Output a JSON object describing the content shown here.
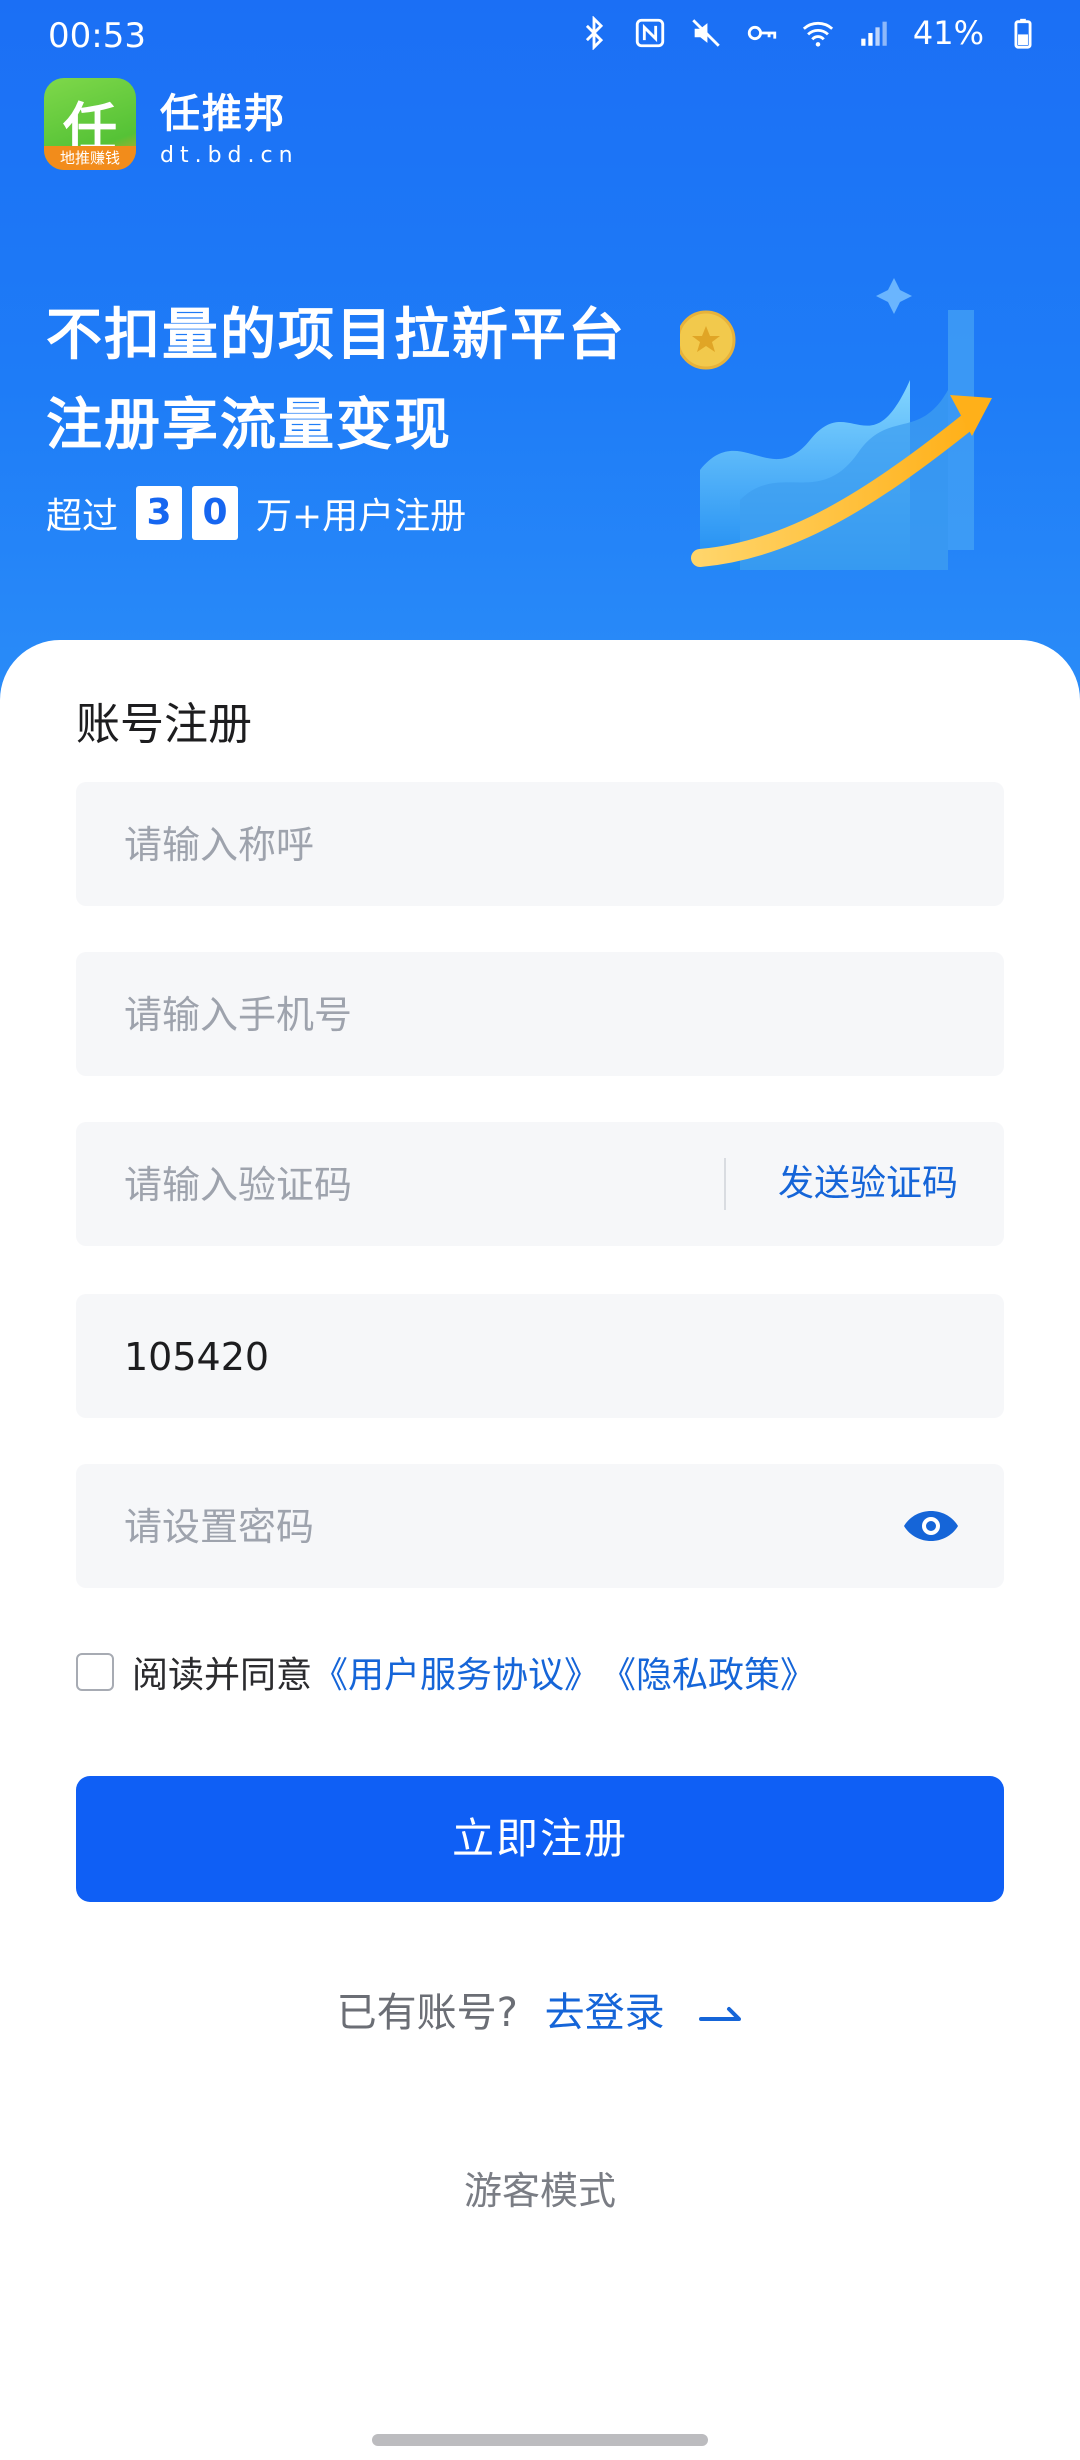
{
  "status_bar": {
    "time": "00:53",
    "battery": "41%"
  },
  "brand": {
    "logo_glyph": "任",
    "logo_band": "地推赚钱",
    "name": "任推邦",
    "domain": "dt.bd.cn"
  },
  "hero": {
    "headline_1": "不扣量的项目拉新平台",
    "headline_2": "注册享流量变现",
    "users_prefix": "超过",
    "users_digit_1": "3",
    "users_digit_2": "0",
    "users_suffix": "万+用户注册"
  },
  "form": {
    "title": "账号注册",
    "nickname_placeholder": "请输入称呼",
    "phone_placeholder": "请输入手机号",
    "code_placeholder": "请输入验证码",
    "send_code": "发送验证码",
    "invite_value": "105420",
    "password_placeholder": "请设置密码",
    "agree_text": "阅读并同意",
    "terms_link": "《用户服务协议》",
    "privacy_link": "《隐私政策》",
    "register_button": "立即注册",
    "have_account": "已有账号?",
    "go_login": "去登录",
    "guest_mode": "游客模式"
  },
  "colors": {
    "primary": "#0f5ff5",
    "link": "#1565d8",
    "hero_bg": "#1b6ff5"
  },
  "icons": [
    "bluetooth-icon",
    "nfc-icon",
    "mute-icon",
    "vpn-key-icon",
    "wifi-icon",
    "signal-icon",
    "battery-icon",
    "eye-icon",
    "arrow-right-icon"
  ]
}
